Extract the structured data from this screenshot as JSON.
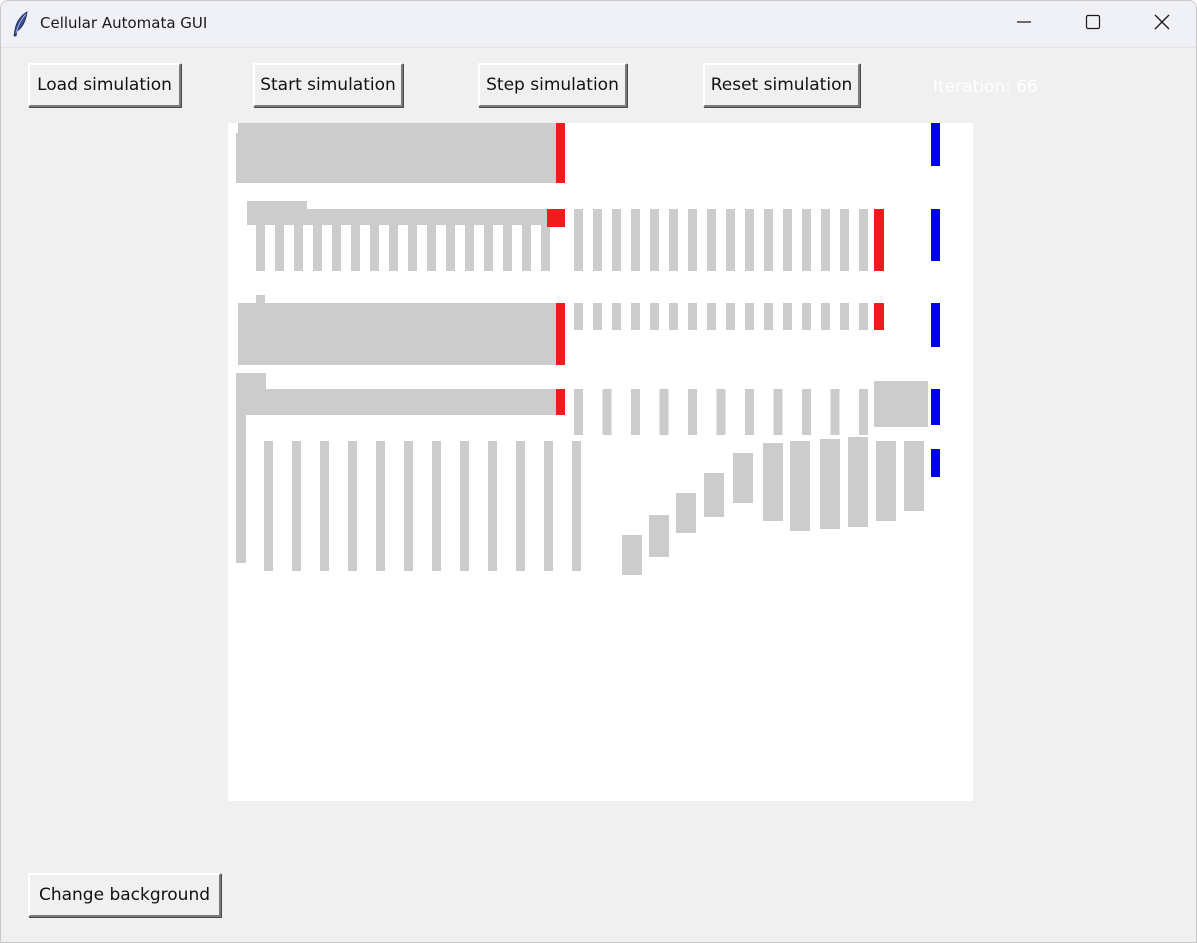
{
  "window": {
    "title": "Cellular Automata GUI",
    "app_icon": "feather-icon",
    "controls": {
      "minimize_icon": "minimize-icon",
      "maximize_icon": "maximize-icon",
      "close_icon": "close-icon"
    }
  },
  "toolbar": {
    "load_label": "Load simulation",
    "start_label": "Start simulation",
    "step_label": "Step simulation",
    "reset_label": "Reset simulation",
    "iteration_label": "Iteration: 66"
  },
  "footer": {
    "change_background_label": "Change background"
  },
  "colors": {
    "window_background": "#f0f0f0",
    "canvas_background": "#ffffff",
    "cell_gray": "#cccccc",
    "cell_red": "#ee1c1c",
    "cell_blue": "#0000ee",
    "iteration_text": "#ffffff"
  }
}
